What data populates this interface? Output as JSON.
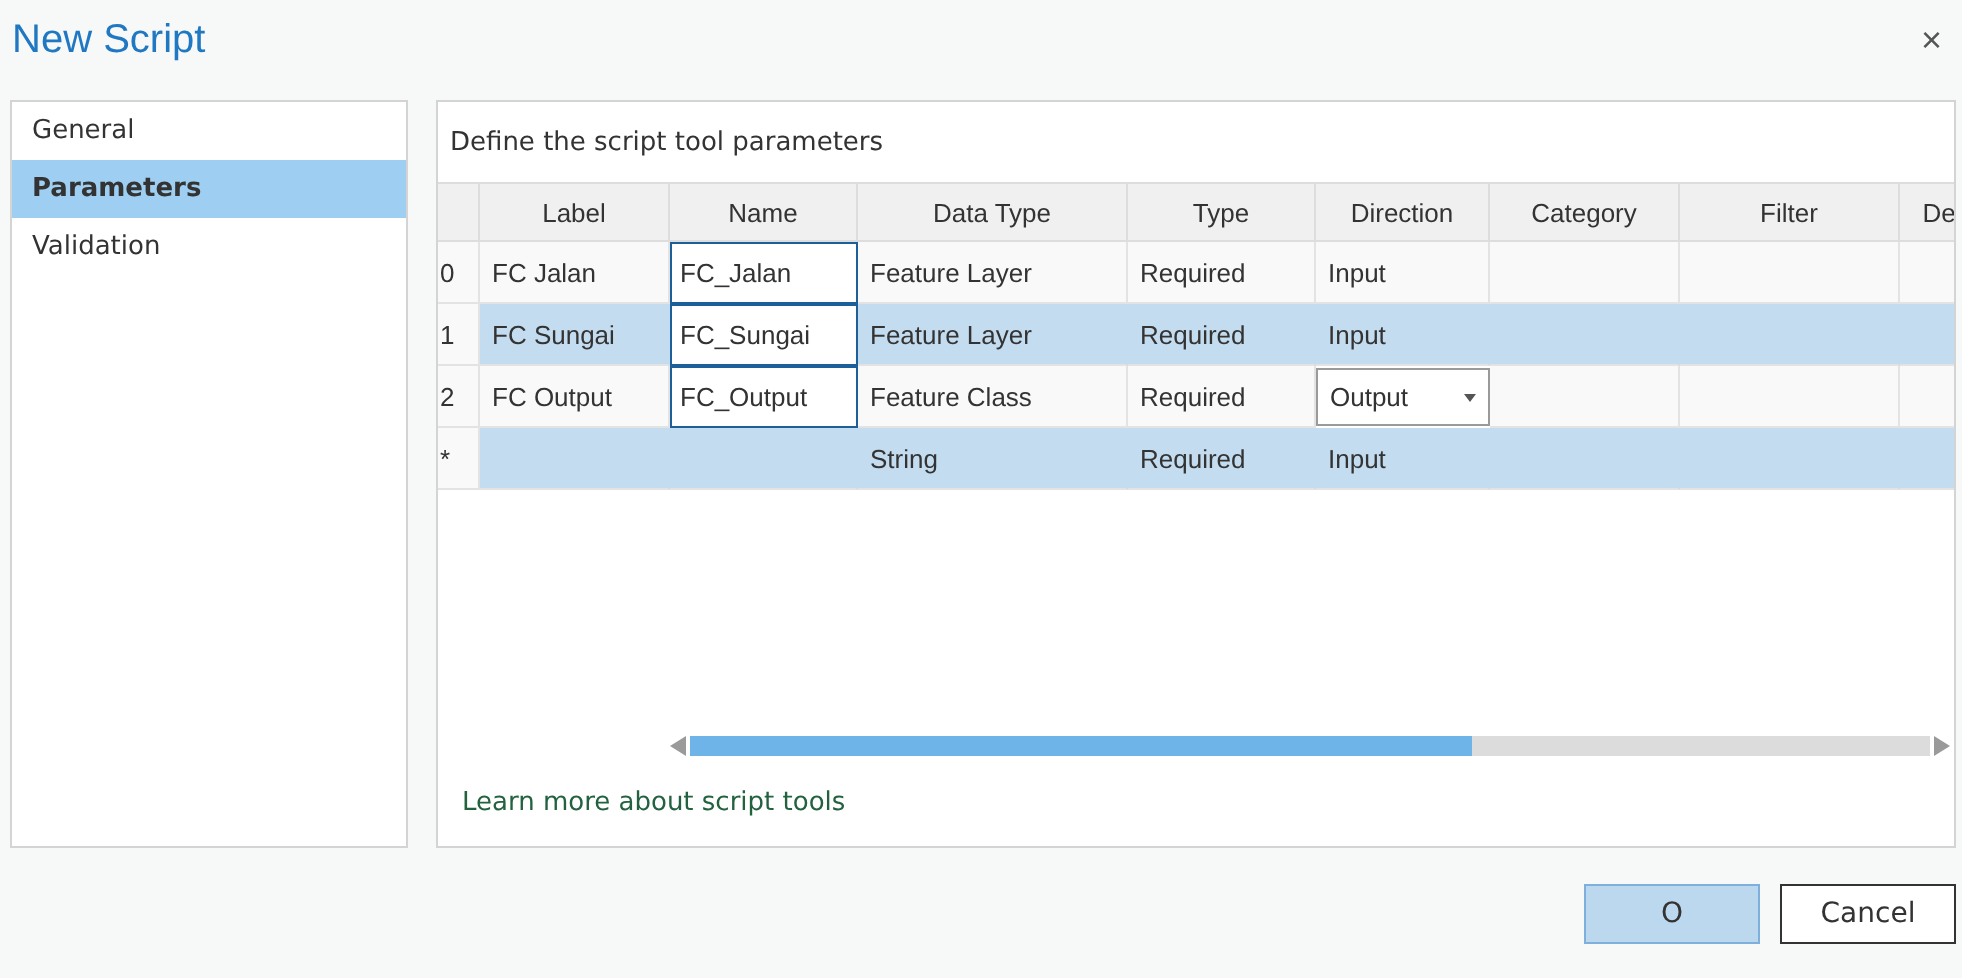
{
  "window": {
    "title": "New Script",
    "close": "×"
  },
  "sidebar": {
    "items": [
      {
        "label": "General",
        "selected": false
      },
      {
        "label": "Parameters",
        "selected": true
      },
      {
        "label": "Validation",
        "selected": false
      }
    ]
  },
  "panel": {
    "heading": "Define the script tool parameters",
    "table": {
      "columns": [
        "Label",
        "Name",
        "Data Type",
        "Type",
        "Direction",
        "Category",
        "Filter",
        "De"
      ],
      "rows": [
        {
          "index": "0",
          "label": "FC Jalan",
          "name": "FC_Jalan",
          "data_type": "Feature Layer",
          "type": "Required",
          "direction": "Input",
          "kind": "plain",
          "selected": false
        },
        {
          "index": "1",
          "label": "FC Sungai",
          "name": "FC_Sungai",
          "data_type": "Feature Layer",
          "type": "Required",
          "direction": "Input",
          "kind": "plain",
          "selected": true
        },
        {
          "index": "2",
          "label": "FC Output",
          "name": "FC_Output",
          "data_type": "Feature Class",
          "type": "Required",
          "direction": "Output",
          "kind": "dropdown",
          "selected": false
        },
        {
          "index": "*",
          "data_type": "String",
          "type": "Required",
          "direction": "Input",
          "kind": "plain",
          "selected": true
        }
      ]
    },
    "link": "Learn more about script tools"
  },
  "buttons": [
    {
      "label": "O",
      "primary": true
    },
    {
      "label": "Cancel",
      "primary": false
    }
  ]
}
